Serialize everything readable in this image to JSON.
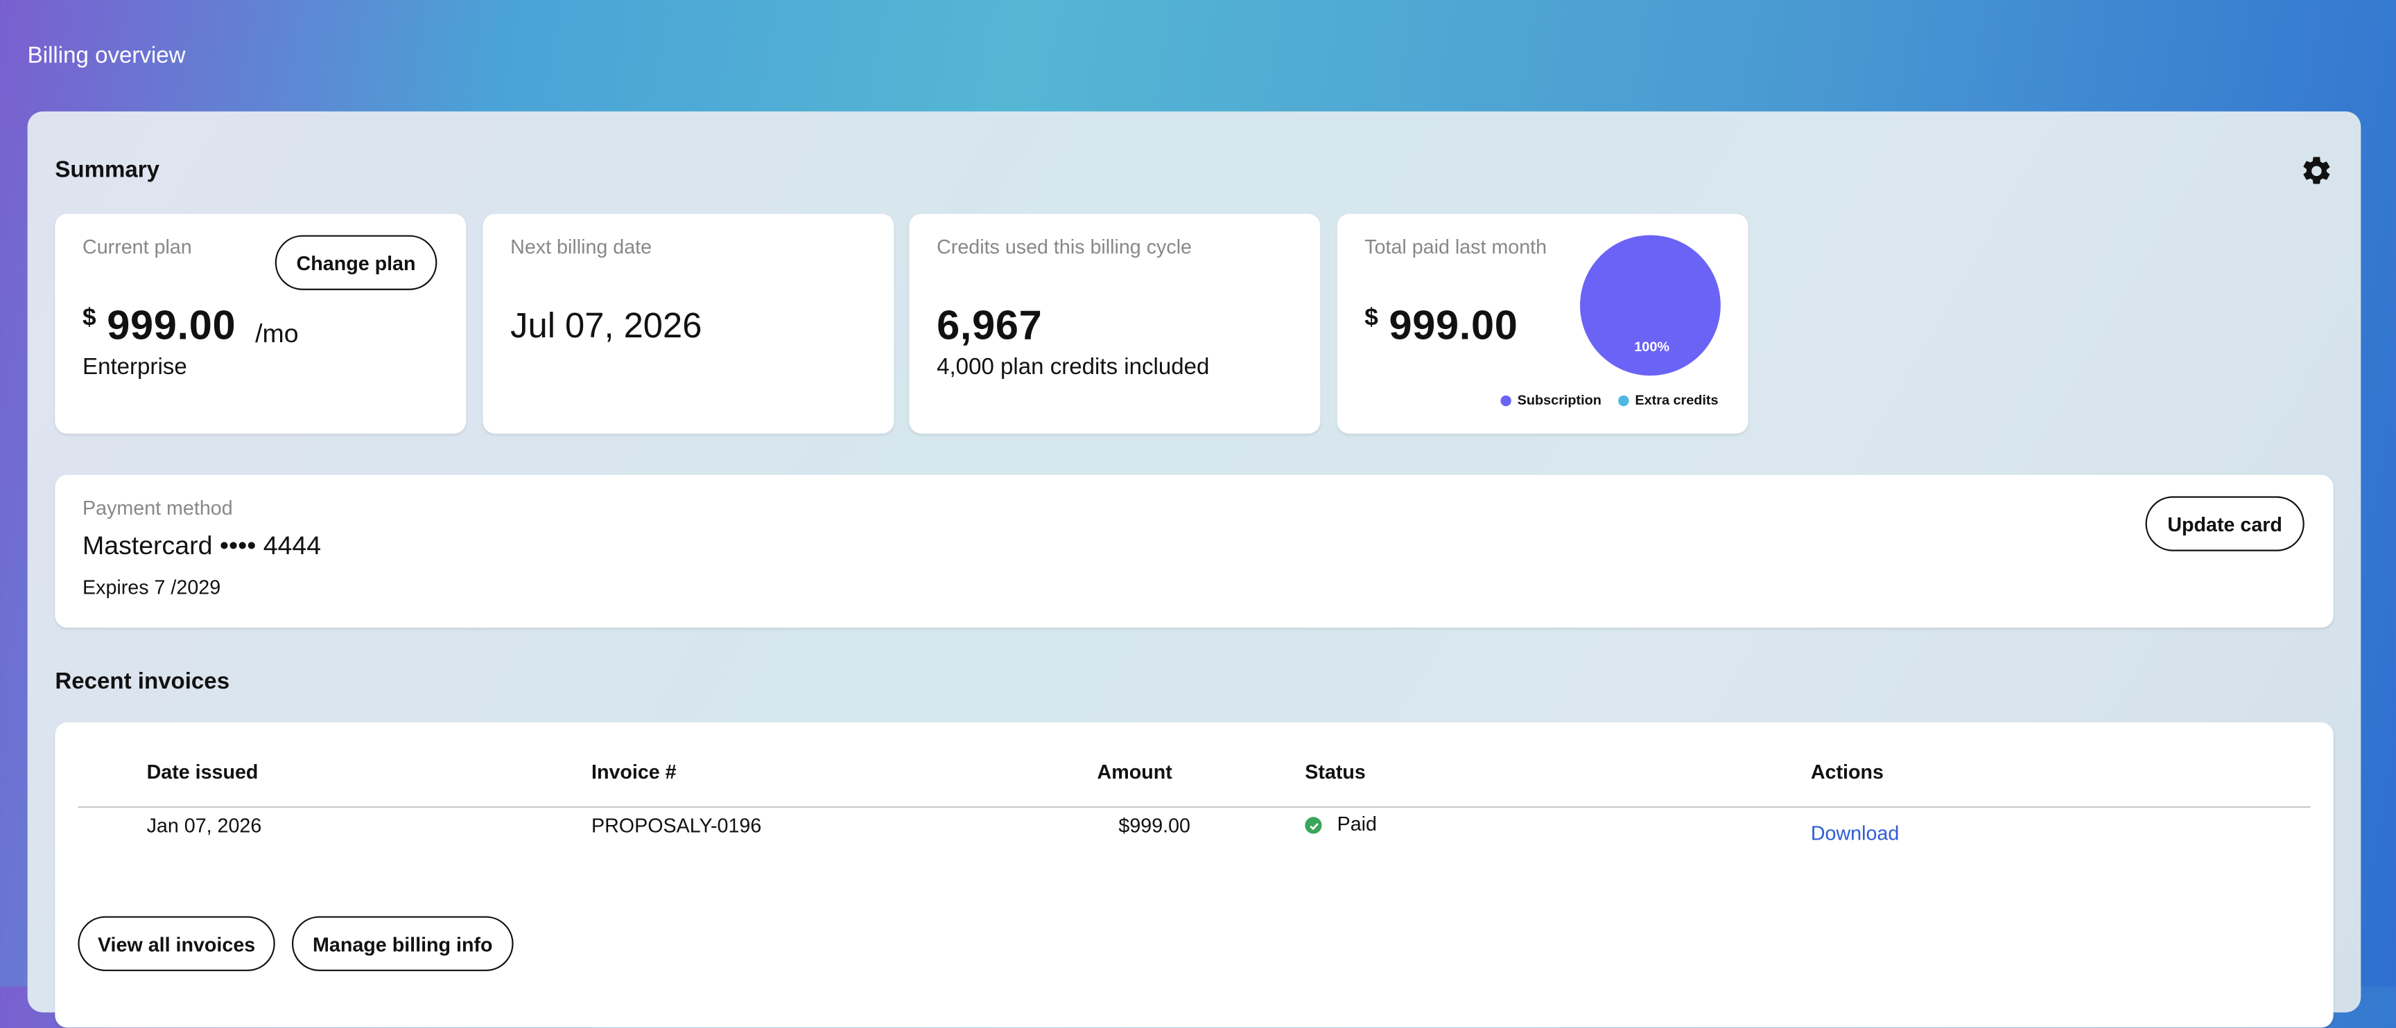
{
  "header": {
    "title": "Billing overview"
  },
  "summary": {
    "title": "Summary",
    "settings_icon": "gear-icon",
    "current_plan": {
      "label": "Current plan",
      "change_button": "Change plan",
      "currency_symbol": "$",
      "price": "999.00",
      "period": "/mo",
      "plan_name": "Enterprise"
    },
    "next_billing": {
      "label": "Next billing date",
      "date": "Jul 07, 2026"
    },
    "credits": {
      "label": "Credits used this billing cycle",
      "used": "6,967",
      "included": "4,000 plan credits included"
    },
    "total_paid": {
      "label": "Total paid last month",
      "currency_symbol": "$",
      "amount": "999.00",
      "pie_label": "100%",
      "legend_subscription": "Subscription",
      "legend_extra": "Extra credits"
    }
  },
  "payment": {
    "label": "Payment method",
    "card": "Mastercard •••• 4444",
    "expires": "Expires 7 /2029",
    "update_button": "Update card"
  },
  "invoices": {
    "title": "Recent invoices",
    "columns": [
      "Date issued",
      "Invoice #",
      "Amount",
      "Status",
      "Actions"
    ],
    "rows": [
      {
        "date": "Jan 07, 2026",
        "number": "PROPOSALY-0196",
        "amount": "$999.00",
        "status": "Paid",
        "action": "Download"
      }
    ],
    "view_all_button": "View all invoices",
    "manage_button": "Manage billing info"
  },
  "colors": {
    "subscription": "#6a63f5",
    "extra_credits": "#4fb8e0",
    "paid_status": "#3aa55a",
    "link": "#2f5bd6"
  },
  "chart_data": {
    "type": "pie",
    "categories": [
      "Subscription",
      "Extra credits"
    ],
    "values": [
      100,
      0
    ],
    "labels": [
      "100%"
    ]
  }
}
